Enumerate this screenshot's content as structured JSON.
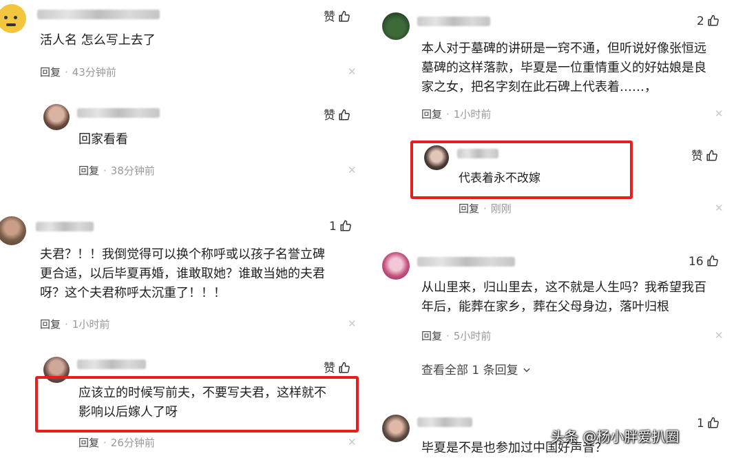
{
  "reply_label": "回复",
  "sep": "·",
  "left": {
    "c1": {
      "text": "活人名 怎么写上去了",
      "time": "43分钟前",
      "like": "赞"
    },
    "c1r1": {
      "text": "回家看看",
      "time": "38分钟前",
      "like": "赞"
    },
    "c2": {
      "lines": [
        "夫君？！！我倒觉得可以换个称呼或以孩子名誉立碑",
        "更合适，以后毕夏再婚，谁敢取她？谁敢当她的夫君",
        "呀？这个夫君称呼太沉重了！！！"
      ],
      "time": "1小时前",
      "like": "1"
    },
    "c2r1": {
      "lines": [
        "应该立的时候写前夫，不要写夫君，这样就不",
        "影响以后嫁人了呀"
      ],
      "time": "26分钟前",
      "like": "赞"
    }
  },
  "right": {
    "c1": {
      "lines": [
        "本人对于墓碑的讲研是一窍不通，但听说好像张恒远",
        "墓碑的这样落款，毕夏是一位重情重义的好姑娘是良",
        "家之女，把名字刻在此石碑上代表着……，"
      ],
      "time": "1小时前",
      "like": "2"
    },
    "c1r1": {
      "text": "代表着永不改嫁",
      "time": "刚刚",
      "like": "赞"
    },
    "c2": {
      "lines": [
        "从山里来，归山里去，这不就是人生吗？我希望我百",
        "年后，能葬在家乡，葬在父母身边，落叶归根"
      ],
      "time": "5小时前",
      "like": "16"
    },
    "c2_expand": "查看全部 1 条回复",
    "c3": {
      "text": "毕夏是不是也参加过中国好声音？",
      "like": "1"
    }
  },
  "watermark": "头条 @杨小胖爱扒圈",
  "colors": {
    "highlight": "#e61e1e"
  },
  "icons": [
    "thumbs-up-icon",
    "close-icon",
    "chevron-down-icon",
    "avatar"
  ]
}
